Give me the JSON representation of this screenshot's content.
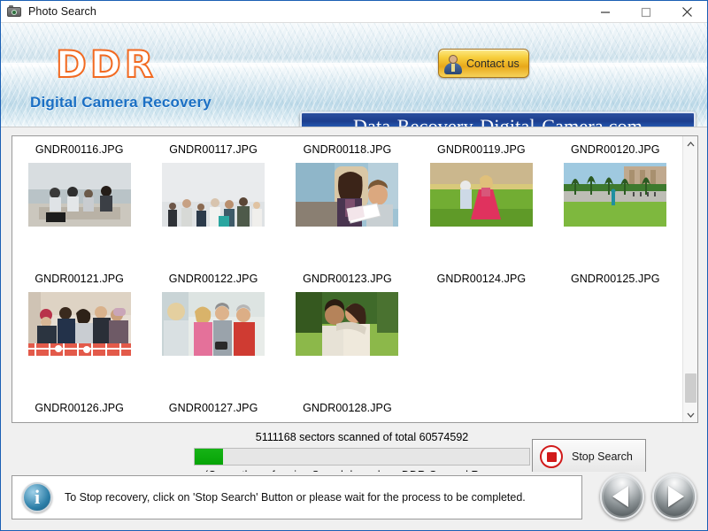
{
  "window": {
    "title": "Photo Search",
    "icon": "camera-icon",
    "controls": {
      "minimize": "minimize-icon",
      "maximize": "maximize-icon",
      "close": "close-icon"
    }
  },
  "branding": {
    "logo": "DDR",
    "tagline": "Digital Camera Recovery",
    "contact_label": "Contact us",
    "url_banner": "Data-Recovery-Digital-Camera.com",
    "colors": {
      "logo_outline": "#f26a21",
      "tagline": "#1a6fc4",
      "url_banner_bg": "#1b3d8e",
      "contact_button": "#f7cf3e"
    }
  },
  "grid": {
    "rows": [
      {
        "cells": [
          {
            "label": "GNDR00116.JPG",
            "thumb": "beach-group"
          },
          {
            "label": "GNDR00117.JPG",
            "thumb": "group-sky"
          },
          {
            "label": "GNDR00118.JPG",
            "thumb": "mother-child-book"
          },
          {
            "label": "GNDR00119.JPG",
            "thumb": "field-kids"
          },
          {
            "label": "GNDR00120.JPG",
            "thumb": "park-palms"
          }
        ]
      },
      {
        "cells": [
          {
            "label": "GNDR00121.JPG",
            "thumb": "cafe-table"
          },
          {
            "label": "GNDR00122.JPG",
            "thumb": "indoor-chat"
          },
          {
            "label": "GNDR00123.JPG",
            "thumb": "couple-outdoors"
          },
          {
            "label": "GNDR00124.JPG",
            "thumb": ""
          },
          {
            "label": "GNDR00125.JPG",
            "thumb": ""
          }
        ]
      },
      {
        "cells": [
          {
            "label": "GNDR00126.JPG",
            "thumb": ""
          },
          {
            "label": "GNDR00127.JPG",
            "thumb": ""
          },
          {
            "label": "GNDR00128.JPG",
            "thumb": ""
          },
          {
            "label": "",
            "thumb": ""
          },
          {
            "label": "",
            "thumb": ""
          }
        ]
      }
    ],
    "scrollbar": {
      "up_icon": "chevron-up-icon",
      "down_icon": "chevron-down-icon"
    }
  },
  "progress": {
    "scan_text": "5111168 sectors scanned of total 60574592",
    "sectors_scanned": 5111168,
    "sectors_total": 60574592,
    "percent": 8.4,
    "procedure_text": "(Currently performing Search based on:  DDR General Recovery Procedure)",
    "fill_color": "#0aa80a"
  },
  "stop_button": {
    "label": "Stop Search",
    "icon": "stop-icon",
    "color": "#d11a1a"
  },
  "footer": {
    "info_icon": "info-icon",
    "info_glyph": "i",
    "message": "To Stop recovery, click on 'Stop Search' Button or please wait for the process to be completed.",
    "prev_icon": "previous-arrow-icon",
    "next_icon": "next-arrow-icon"
  }
}
